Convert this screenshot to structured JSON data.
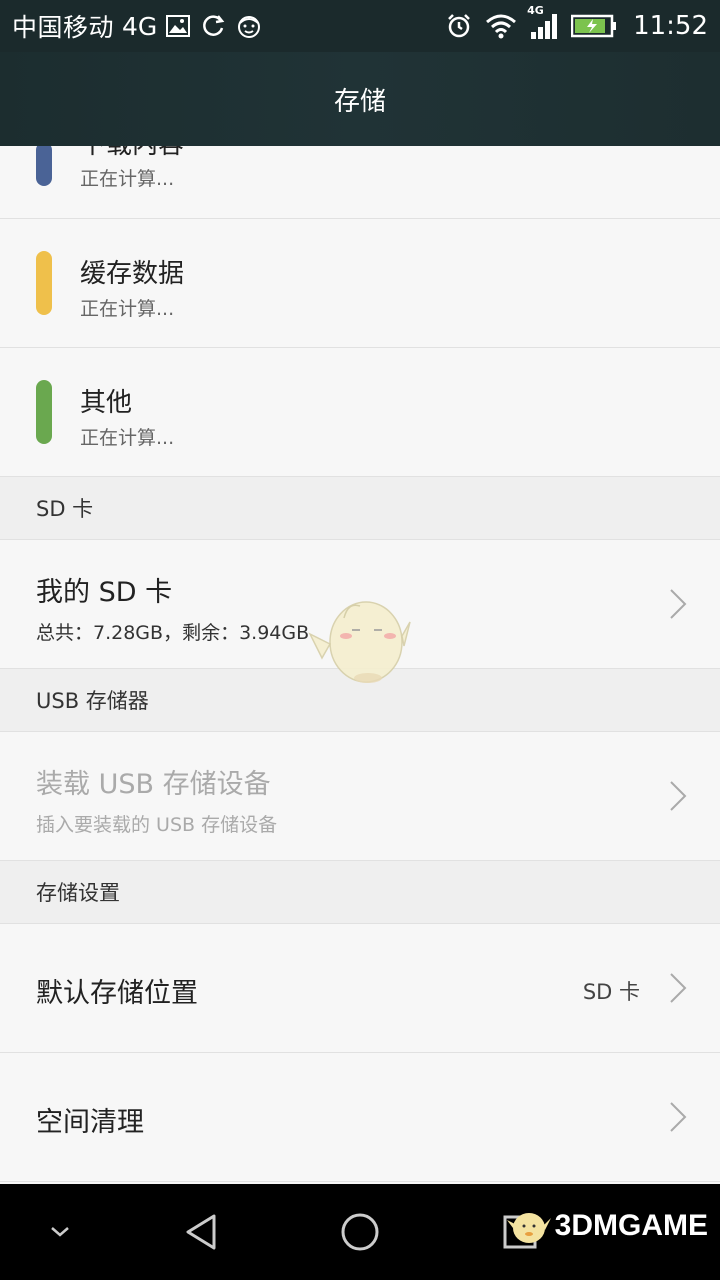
{
  "status_bar": {
    "carrier": "中国移动",
    "network": "4G",
    "signal_network_badge": "4G",
    "time": "11:52",
    "icons_left": [
      "image-icon",
      "sync-icon",
      "face-icon"
    ],
    "icons_right": [
      "alarm-icon",
      "wifi-icon",
      "signal-icon",
      "battery-charging-icon"
    ]
  },
  "app_bar": {
    "title": "存储"
  },
  "storage_items": [
    {
      "title": "下载内容",
      "subtitle": "正在计算...",
      "color": "#4a6396"
    },
    {
      "title": "缓存数据",
      "subtitle": "正在计算...",
      "color": "#efc04b"
    },
    {
      "title": "其他",
      "subtitle": "正在计算...",
      "color": "#6aa84f"
    }
  ],
  "sections": {
    "sd_card": {
      "header": "SD 卡",
      "item_title": "我的 SD 卡",
      "item_subtitle": "总共：7.28GB，剩余：3.94GB"
    },
    "usb": {
      "header": "USB 存储器",
      "item_title": "装载 USB 存储设备",
      "item_subtitle": "插入要装载的 USB 存储设备"
    },
    "settings": {
      "header": "存储设置",
      "default_location_label": "默认存储位置",
      "default_location_value": "SD 卡",
      "cleanup_label": "空间清理"
    }
  },
  "nav_bar": {
    "buttons": [
      "hide-nav-icon",
      "back-icon",
      "home-icon",
      "recents-icon"
    ],
    "watermark": "3DMGAME"
  },
  "colors": {
    "status_bar": "#1b2a2c",
    "background": "#f7f7f7",
    "section_header": "#efefef"
  }
}
